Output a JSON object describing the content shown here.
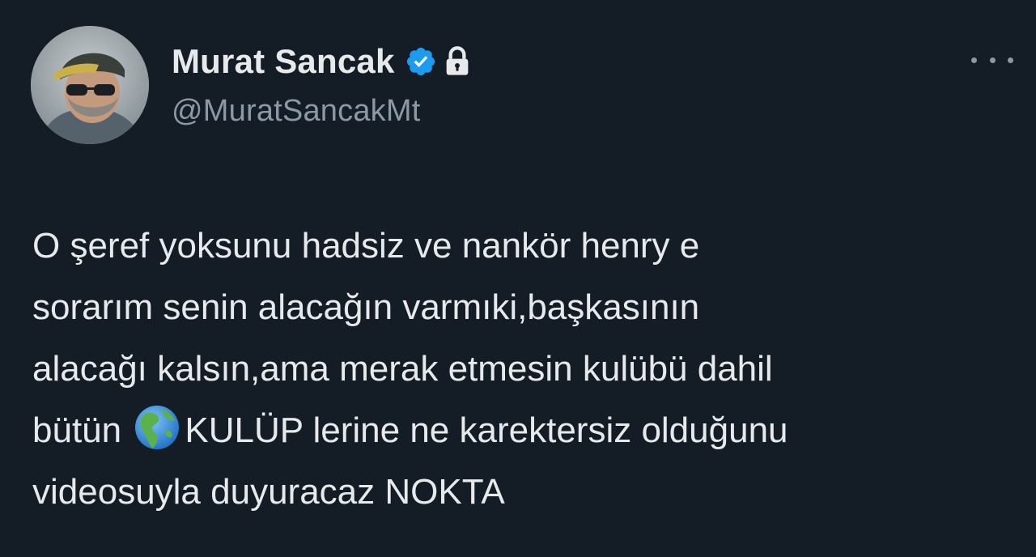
{
  "author": {
    "display_name": "Murat Sancak",
    "handle": "@MuratSancakMt",
    "verified_icon": "verified-badge-icon",
    "protected_icon": "lock-icon",
    "badge_color": "#1d9bf0"
  },
  "tweet": {
    "line1": "O şeref yoksunu hadsiz ve nankör henry e",
    "line2": "sorarım senin alacağın varmıki,başkasının",
    "line3": "alacağı kalsın,ama merak etmesin kulübü dahil",
    "line4_before": "bütün ",
    "line4_emoji": "globe-americas-icon",
    "line4_after": "KULÜP lerine ne karektersiz olduğunu",
    "line5": "videosuyla duyuracaz NOKTA"
  },
  "more_menu": {
    "icon": "more-horizontal-icon"
  },
  "theme": {
    "background": "#141d26",
    "text": "#e7e9ea",
    "secondary_text": "#8b98a5"
  }
}
